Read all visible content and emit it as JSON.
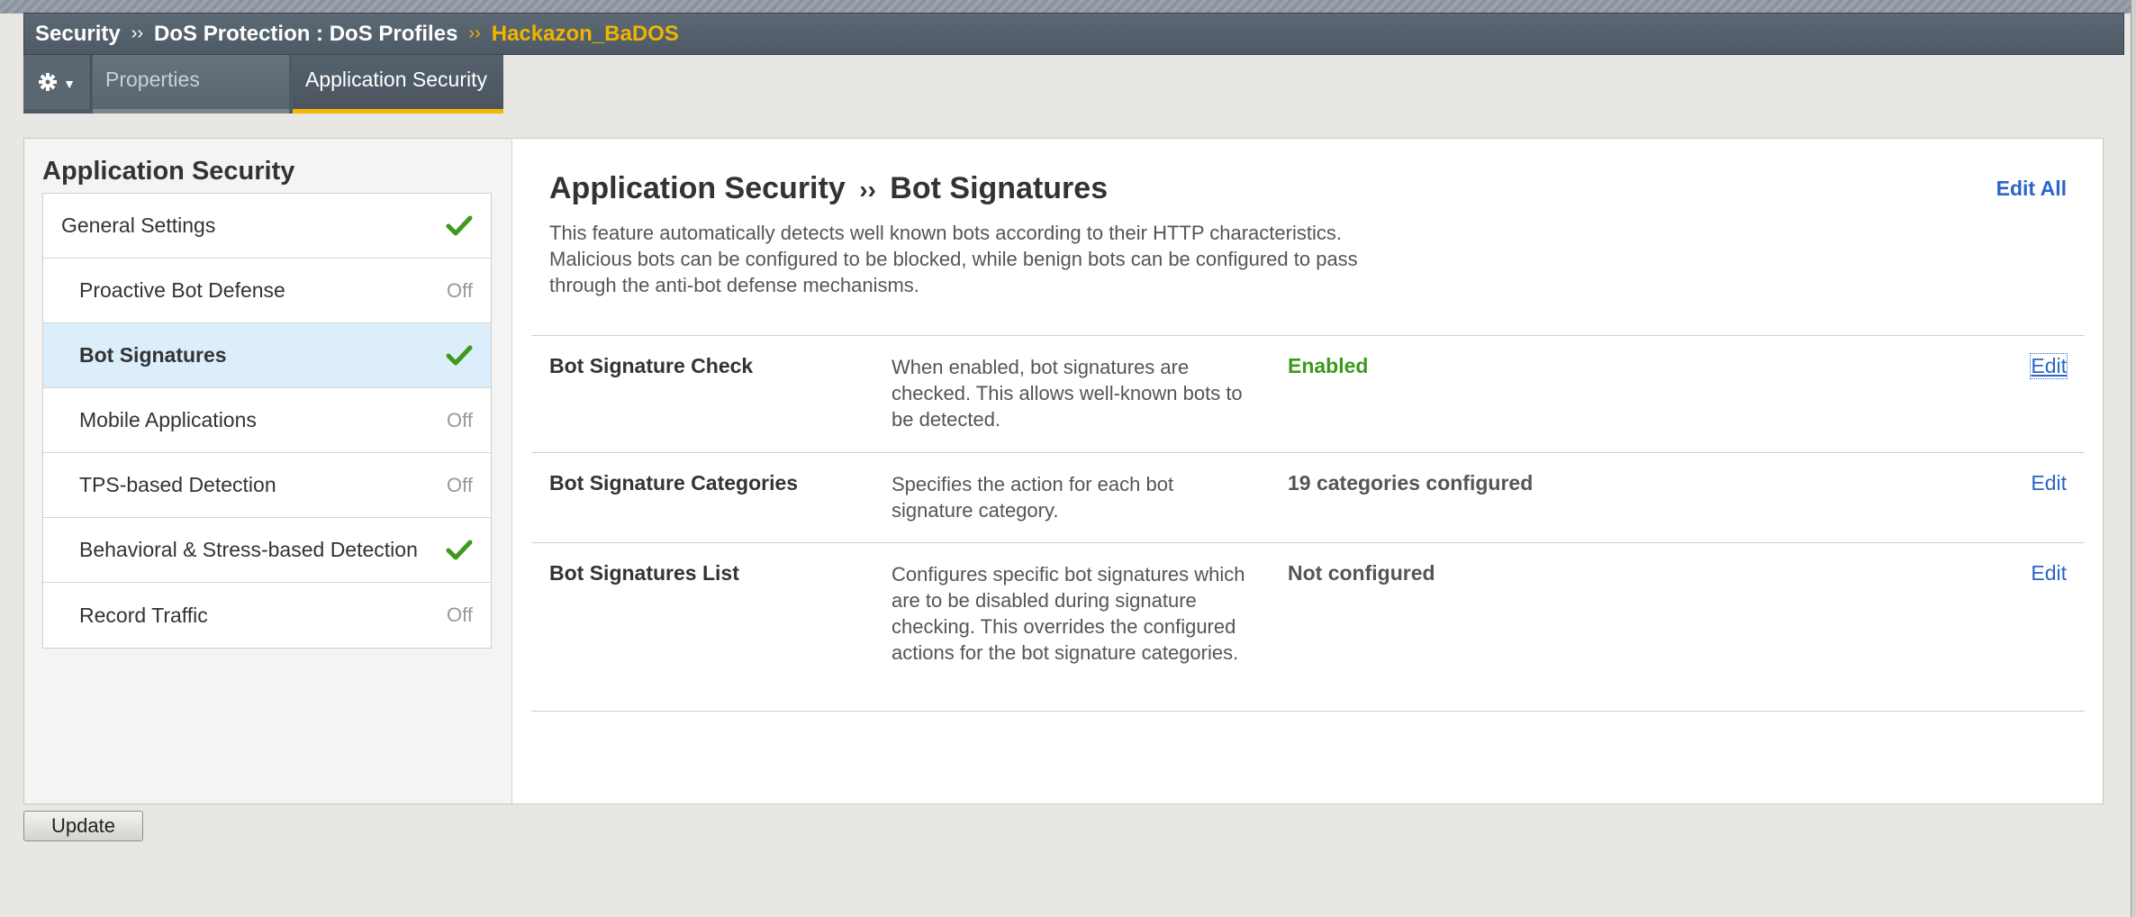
{
  "breadcrumb": {
    "items": [
      "Security",
      "DoS Protection : DoS Profiles"
    ],
    "separator": "››",
    "current": "Hackazon_BaDOS"
  },
  "tabs": {
    "gear_icon": "gear-icon",
    "properties": "Properties",
    "application_security": "Application Security"
  },
  "sidebar": {
    "title": "Application Security",
    "items": [
      {
        "label": "General Settings",
        "status": "check",
        "status_text": ""
      },
      {
        "label": "Proactive Bot Defense",
        "status": "off",
        "status_text": "Off"
      },
      {
        "label": "Bot Signatures",
        "status": "check",
        "status_text": ""
      },
      {
        "label": "Mobile Applications",
        "status": "off",
        "status_text": "Off"
      },
      {
        "label": "TPS-based Detection",
        "status": "off",
        "status_text": "Off"
      },
      {
        "label": "Behavioral & Stress-based Detection",
        "status": "check",
        "status_text": ""
      },
      {
        "label": "Record Traffic",
        "status": "off",
        "status_text": "Off"
      }
    ],
    "selected_index": 2
  },
  "main": {
    "title_parent": "Application Security",
    "title_sep": "››",
    "title_child": "Bot Signatures",
    "edit_all": "Edit All",
    "description": "This feature automatically detects well known bots according to their HTTP characteristics. Malicious bots can be configured to be blocked, while benign bots can be configured to pass through the anti-bot defense mechanisms.",
    "rows": [
      {
        "name": "Bot Signature Check",
        "description": "When enabled, bot signatures are checked. This allows well-known bots to be detected.",
        "value": "Enabled",
        "edit": "Edit"
      },
      {
        "name": "Bot Signature Categories",
        "description": "Specifies the action for each bot signature category.",
        "value": "19 categories configured",
        "edit": "Edit"
      },
      {
        "name": "Bot Signatures List",
        "description": "Configures specific bot signatures which are to be disabled during signature checking. This overrides the configured actions for the bot signature categories.",
        "value": "Not configured",
        "edit": "Edit"
      }
    ]
  },
  "footer": {
    "update_label": "Update"
  },
  "colors": {
    "accent": "#f5b800",
    "link": "#2a66c5",
    "enabled": "#3d9a1d",
    "selected_bg": "#dbeefa"
  }
}
